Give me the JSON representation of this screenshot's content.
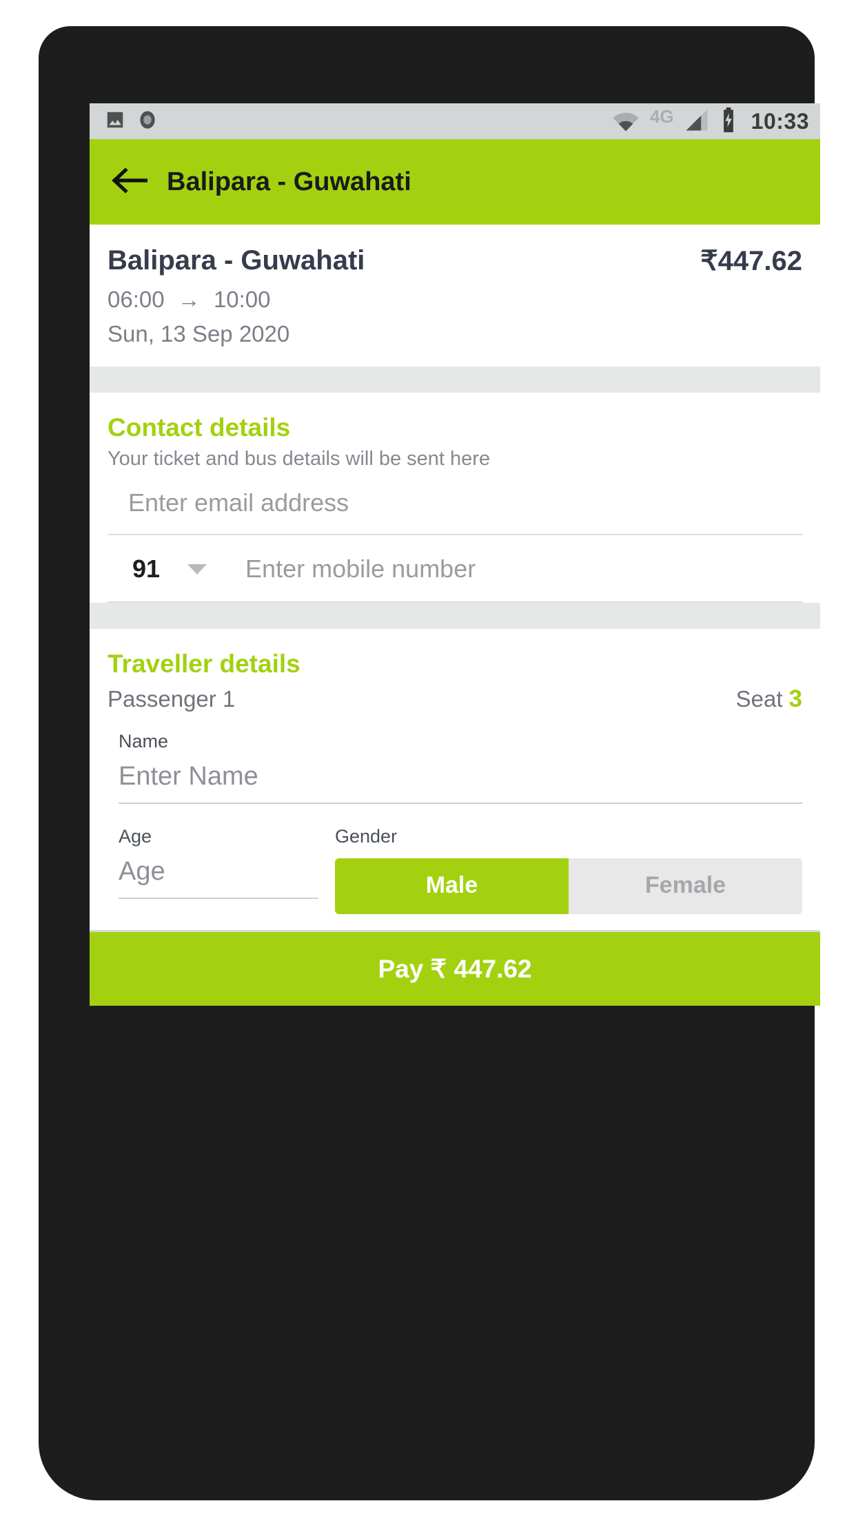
{
  "status_bar": {
    "icons": [
      "image-icon",
      "camera-icon",
      "wifi-icon",
      "signal-icon",
      "battery-charging-icon"
    ],
    "network": "4G",
    "time": "10:33"
  },
  "app_bar": {
    "back_icon": "arrow-back-icon",
    "title": "Balipara - Guwahati"
  },
  "journey": {
    "route": "Balipara - Guwahati",
    "fare": "₹447.62",
    "departure_time": "06:00",
    "arrow": "→",
    "arrival_time": "10:00",
    "date": "Sun, 13 Sep 2020"
  },
  "contact": {
    "title": "Contact details",
    "subtitle": "Your ticket and bus details will be sent here",
    "email_placeholder": "Enter email address",
    "country_code": "91",
    "dropdown_icon": "chevron-down-icon",
    "mobile_placeholder": "Enter mobile number"
  },
  "traveller": {
    "title": "Traveller details",
    "passenger_label": "Passenger 1",
    "seat_label": "Seat",
    "seat_number": "3",
    "name_label": "Name",
    "name_placeholder": "Enter Name",
    "age_label": "Age",
    "age_placeholder": "Age",
    "gender_label": "Gender",
    "gender_male": "Male",
    "gender_female": "Female",
    "gender_selected": "Male"
  },
  "pay": {
    "label": "Pay ₹ 447.62"
  },
  "colors": {
    "brand_green": "#a3d110",
    "text_dark": "#363b4d",
    "text_muted": "#7a7f87",
    "status_bar_bg": "#d3d6d6",
    "band_gray": "#e6e8e8"
  }
}
